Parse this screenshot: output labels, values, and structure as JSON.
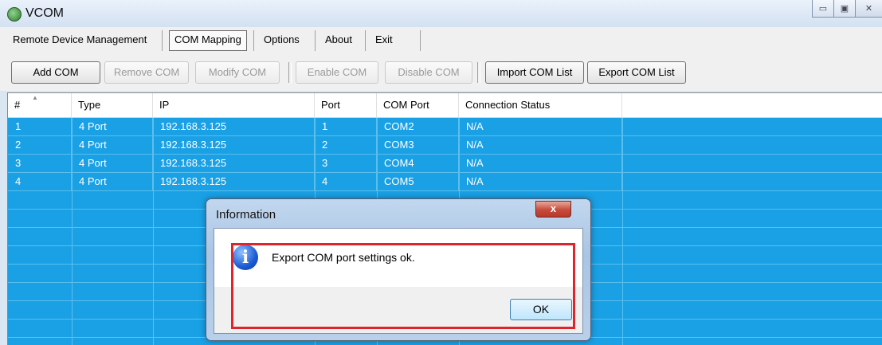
{
  "window": {
    "title": "VCOM",
    "minimize_label": "▭",
    "maximize_label": "▣",
    "close_label": "✕"
  },
  "menu": [
    {
      "label": "Remote Device Management",
      "active": false
    },
    {
      "label": "COM Mapping",
      "active": true
    },
    {
      "label": "Options",
      "active": false
    },
    {
      "label": "About",
      "active": false
    },
    {
      "label": "Exit",
      "active": false
    }
  ],
  "toolbar": {
    "add_com": "Add COM",
    "remove_com": "Remove COM",
    "modify_com": "Modify COM",
    "enable_com": "Enable COM",
    "disable_com": "Disable COM",
    "import_com_list": "Import COM List",
    "export_com_list": "Export COM List"
  },
  "table": {
    "columns": [
      "#",
      "Type",
      "IP",
      "Port",
      "COM Port",
      "Connection Status"
    ],
    "rows": [
      [
        "1",
        "4 Port",
        "192.168.3.125",
        "1",
        "COM2",
        "N/A"
      ],
      [
        "2",
        "4 Port",
        "192.168.3.125",
        "2",
        "COM3",
        "N/A"
      ],
      [
        "3",
        "4 Port",
        "192.168.3.125",
        "3",
        "COM4",
        "N/A"
      ],
      [
        "4",
        "4 Port",
        "192.168.3.125",
        "4",
        "COM5",
        "N/A"
      ]
    ],
    "selection_color": "#1aa0e5"
  },
  "dialog": {
    "title": "Information",
    "message": "Export COM port settings ok.",
    "ok_label": "OK",
    "close_label": "x",
    "icon": "info-icon",
    "highlight_color": "#e0242c"
  }
}
